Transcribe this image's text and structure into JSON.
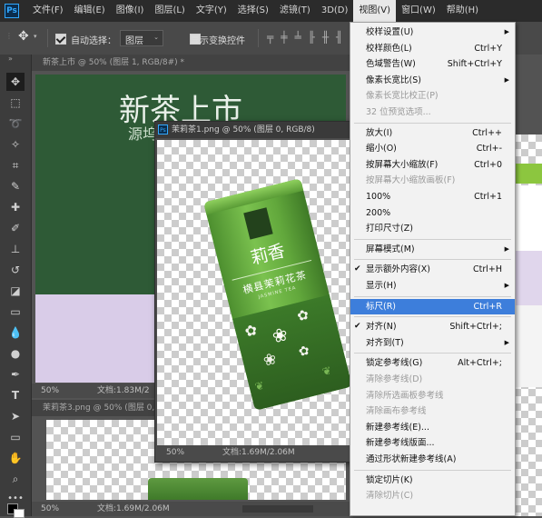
{
  "menubar": {
    "logo": "Ps",
    "items": [
      "文件(F)",
      "编辑(E)",
      "图像(I)",
      "图层(L)",
      "文字(Y)",
      "选择(S)",
      "滤镜(T)",
      "3D(D)",
      "视图(V)",
      "窗口(W)",
      "帮助(H)"
    ],
    "active_index": 8
  },
  "optionsbar": {
    "auto_select_label": "自动选择：",
    "auto_select_value": "图层",
    "show_transform_label": "显示变换控件"
  },
  "doc1": {
    "tab": "新茶上市 @ 50% (图层 1, RGB/8#) *",
    "heading": "新茶上市",
    "subheading": "源坞",
    "zoom": "50%",
    "doc_size": "文档:1.83M/2"
  },
  "doc2": {
    "tab": "茉莉茶1.png @ 50% (图层 0, RGB/8)",
    "tin_title": "莉香",
    "tin_subtitle": "横县茉莉花茶",
    "tin_english": "JASMINE TEA",
    "zoom": "50%",
    "doc_size": "文档:1.69M/2.06M"
  },
  "doc3": {
    "tab": "茉莉茶3.png @ 50% (图层 0, RGB/8)",
    "zoom": "50%",
    "doc_size": "文档:1.69M/2.06M"
  },
  "view_menu": {
    "items": [
      {
        "label": "校样设置(U)",
        "arrow": true
      },
      {
        "label": "校样颜色(L)",
        "shortcut": "Ctrl+Y"
      },
      {
        "label": "色域警告(W)",
        "shortcut": "Shift+Ctrl+Y"
      },
      {
        "label": "像素长宽比(S)",
        "arrow": true
      },
      {
        "label": "像素长宽比校正(P)",
        "disabled": true
      },
      {
        "label": "32 位预览选项...",
        "disabled": true
      },
      {
        "sep": true
      },
      {
        "label": "放大(I)",
        "shortcut": "Ctrl++"
      },
      {
        "label": "缩小(O)",
        "shortcut": "Ctrl+-"
      },
      {
        "label": "按屏幕大小缩放(F)",
        "shortcut": "Ctrl+0"
      },
      {
        "label": "按屏幕大小缩放画板(F)",
        "disabled": true
      },
      {
        "label": "100%",
        "shortcut": "Ctrl+1"
      },
      {
        "label": "200%"
      },
      {
        "label": "打印尺寸(Z)"
      },
      {
        "sep": true
      },
      {
        "label": "屏幕模式(M)",
        "arrow": true
      },
      {
        "sep": true
      },
      {
        "label": "显示额外内容(X)",
        "shortcut": "Ctrl+H",
        "checked": true
      },
      {
        "label": "显示(H)",
        "arrow": true
      },
      {
        "sep": true
      },
      {
        "label": "标尺(R)",
        "shortcut": "Ctrl+R",
        "highlighted": true
      },
      {
        "sep": true
      },
      {
        "label": "对齐(N)",
        "shortcut": "Shift+Ctrl+;",
        "checked": true
      },
      {
        "label": "对齐到(T)",
        "arrow": true
      },
      {
        "sep": true
      },
      {
        "label": "锁定参考线(G)",
        "shortcut": "Alt+Ctrl+;"
      },
      {
        "label": "清除参考线(D)",
        "disabled": true
      },
      {
        "label": "清除所选画板参考线",
        "disabled": true
      },
      {
        "label": "清除画布参考线",
        "disabled": true
      },
      {
        "label": "新建参考线(E)..."
      },
      {
        "label": "新建参考线版面..."
      },
      {
        "label": "通过形状新建参考线(A)"
      },
      {
        "sep": true
      },
      {
        "label": "锁定切片(K)"
      },
      {
        "label": "清除切片(C)",
        "disabled": true
      }
    ]
  },
  "colors": {
    "accent": "#3d7edb",
    "doc1_green": "#2e5a36",
    "doc1_lavender": "#d9cce8",
    "tin_green": "#5da43a"
  }
}
